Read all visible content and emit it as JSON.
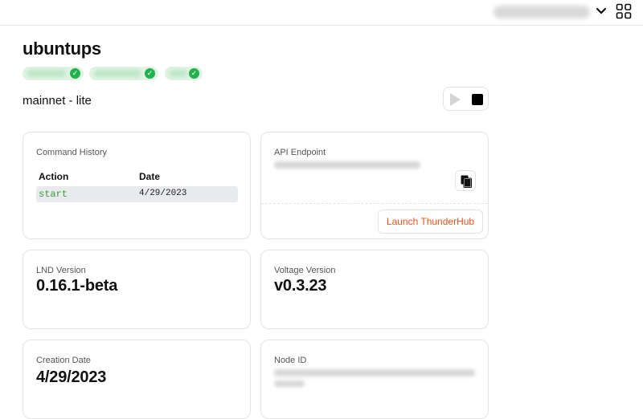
{
  "header": {
    "title": "ubuntups",
    "network": "mainnet - lite"
  },
  "top_bar": {
    "account_icon": "chevron-down-icon",
    "apps_icon": "grid-icon"
  },
  "status_pills": [
    {
      "state": "ok"
    },
    {
      "state": "ok"
    },
    {
      "state": "ok"
    }
  ],
  "controls": {
    "play_icon": "play-icon",
    "stop_icon": "stop-icon"
  },
  "command_history": {
    "label": "Command History",
    "columns": [
      "Action",
      "Date"
    ],
    "rows": [
      {
        "action": "start",
        "date": "4/29/2023"
      }
    ]
  },
  "api_endpoint": {
    "label": "API Endpoint",
    "launch_label": "Launch ThunderHub",
    "copy_icon": "copy-icon"
  },
  "lnd_version": {
    "label": "LND Version",
    "value": "0.16.1-beta"
  },
  "voltage_version": {
    "label": "Voltage Version",
    "value": "v0.3.23"
  },
  "creation_date": {
    "label": "Creation Date",
    "value": "4/29/2023"
  },
  "node_id": {
    "label": "Node ID"
  },
  "colors": {
    "accent_orange": "#e8531a",
    "status_green": "#22b14c",
    "command_green": "#3a9d3a"
  }
}
